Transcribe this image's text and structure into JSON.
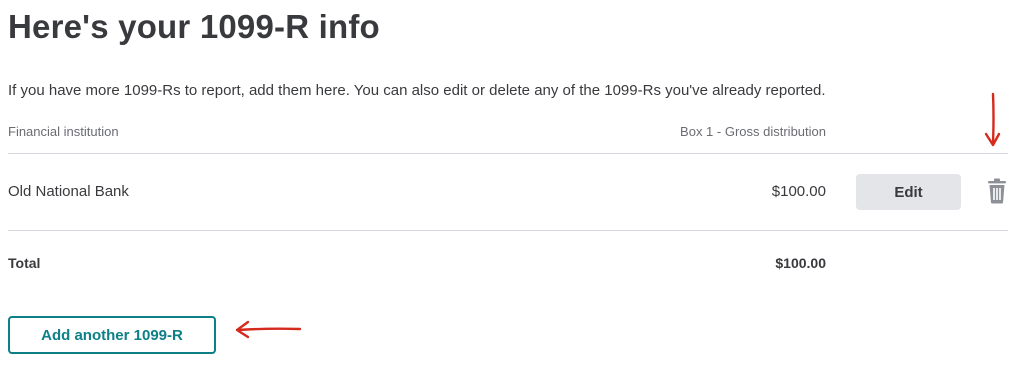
{
  "page": {
    "title": "Here's your 1099-R info",
    "intro": {
      "part1": "If you have more 1099-Rs to report, ",
      "add_link": "add",
      "part2": " them here. You can also ",
      "edit_link": "edit",
      "part3": " or ",
      "delete_link": "delete",
      "part4": " any of the 1099-Rs you've already reported."
    }
  },
  "table": {
    "headers": {
      "institution": "Financial institution",
      "box1": "Box 1 - Gross distribution"
    },
    "rows": [
      {
        "institution": "Old National Bank",
        "amount": "$100.00",
        "edit_label": "Edit",
        "delete_icon": "trash-icon"
      }
    ],
    "total": {
      "label": "Total",
      "amount": "$100.00"
    }
  },
  "actions": {
    "add_another_label": "Add another 1099-R"
  },
  "colors": {
    "text": "#393a3d",
    "muted": "#6b6c72",
    "accent": "#0d7f87",
    "edit_bg": "#e3e5e8",
    "annotation_arrow": "#d52b1e"
  },
  "annotations": [
    {
      "type": "arrow",
      "direction": "down",
      "target": "trash-icon"
    },
    {
      "type": "arrow",
      "direction": "left",
      "target": "add-another-button"
    }
  ]
}
